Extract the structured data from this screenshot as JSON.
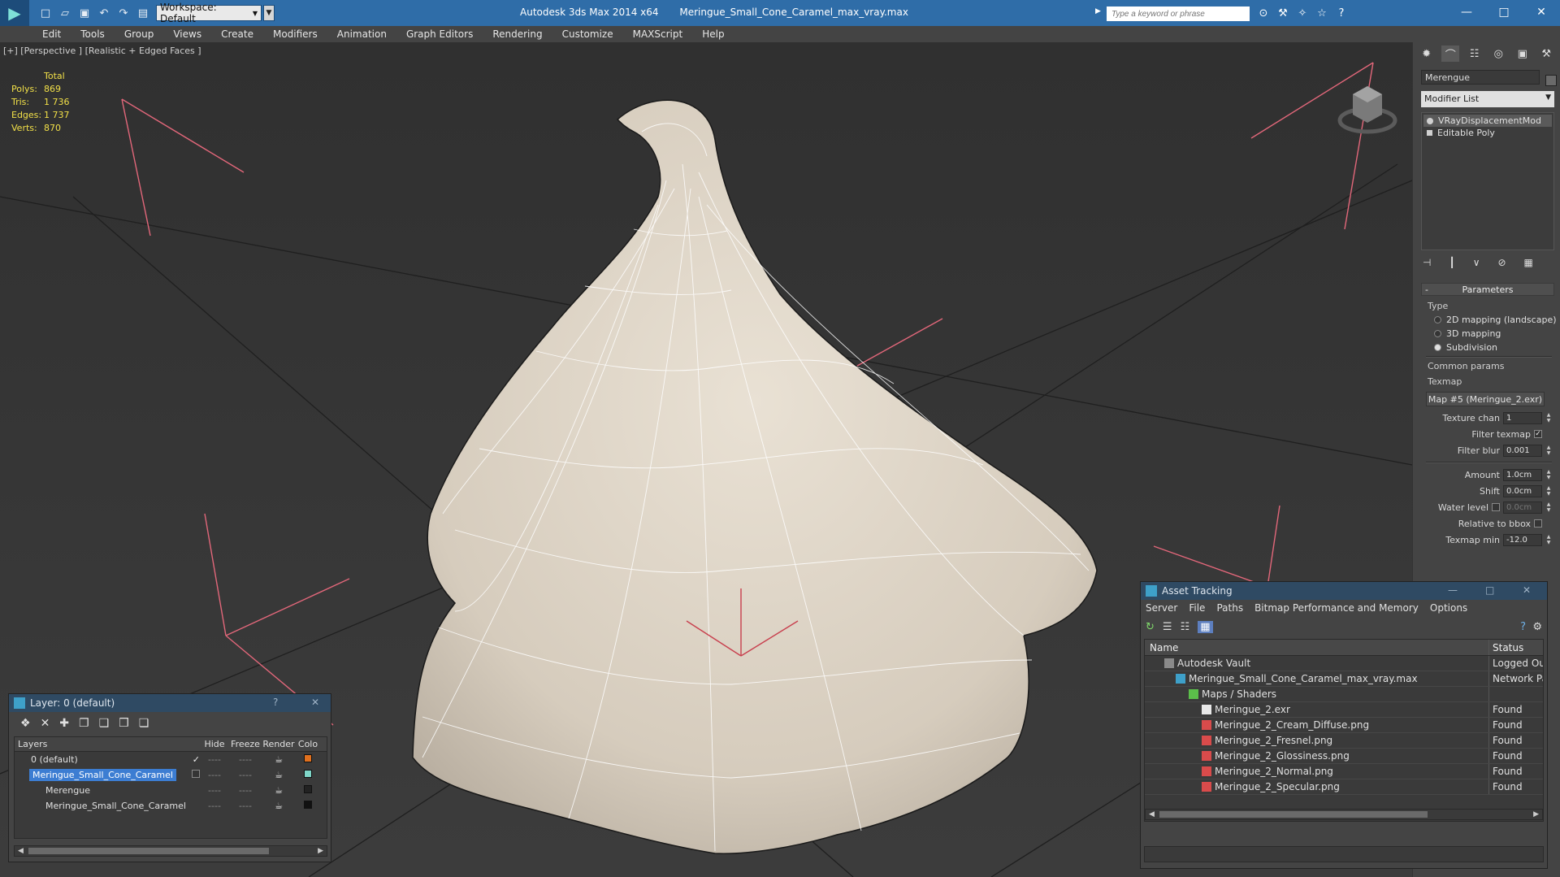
{
  "titlebar": {
    "workspace": "Workspace: Default",
    "app_title": "Autodesk 3ds Max  2014 x64",
    "file_title": "Meringue_Small_Cone_Caramel_max_vray.max",
    "search_placeholder": "Type a keyword or phrase"
  },
  "menu": [
    "Edit",
    "Tools",
    "Group",
    "Views",
    "Create",
    "Modifiers",
    "Animation",
    "Graph Editors",
    "Rendering",
    "Customize",
    "MAXScript",
    "Help"
  ],
  "viewport": {
    "label": "[+] [Perspective ] [Realistic + Edged Faces ]",
    "stats": {
      "header": "Total",
      "rows": [
        {
          "k": "Polys:",
          "v": "869"
        },
        {
          "k": "Tris:",
          "v": "1 736"
        },
        {
          "k": "Edges:",
          "v": "1 737"
        },
        {
          "k": "Verts:",
          "v": "870"
        }
      ]
    },
    "colors": {
      "grid": "#1e1e1e",
      "mesh": "#d9cfc0",
      "wire": "#ffffff",
      "bbox": "#e06a7a"
    }
  },
  "command_panel": {
    "object_name": "Merengue",
    "modifier_list": "Modifier List",
    "stack": [
      "VRayDisplacementMod",
      "Editable Poly"
    ],
    "rollout": "Parameters",
    "type_label": "Type",
    "type_options": [
      "2D mapping (landscape)",
      "3D mapping",
      "Subdivision"
    ],
    "selected_type": "Subdivision",
    "common_label": "Common params",
    "texmap_label": "Texmap",
    "texmap_value": "Map #5 (Meringue_2.exr)",
    "texture_chan_label": "Texture chan",
    "texture_chan": "1",
    "filter_texmap_label": "Filter texmap",
    "filter_blur_label": "Filter blur",
    "filter_blur": "0.001",
    "amount_label": "Amount",
    "amount": "1.0cm",
    "shift_label": "Shift",
    "shift": "0.0cm",
    "water_label": "Water level",
    "water": "0.0cm",
    "relative_label": "Relative to bbox",
    "texmap_min_label": "Texmap min",
    "texmap_min": "-12.0"
  },
  "layer_window": {
    "title": "Layer: 0 (default)",
    "help": "?",
    "columns": [
      "Layers",
      "Hide",
      "Freeze",
      "Render",
      "Colo"
    ],
    "rows": [
      {
        "name": "0 (default)",
        "color": "#e0701e"
      },
      {
        "name": "Meringue_Small_Cone_Caramel",
        "color": "#7fd6c8"
      },
      {
        "name": "Merengue",
        "color": "#222222"
      },
      {
        "name": "Meringue_Small_Cone_Caramel",
        "color": "#111111"
      }
    ]
  },
  "asset_window": {
    "title": "Asset Tracking",
    "menu": [
      "Server",
      "File",
      "Paths",
      "Bitmap Performance and Memory",
      "Options"
    ],
    "columns": [
      "Name",
      "Status"
    ],
    "rows": [
      {
        "name": "Autodesk Vault",
        "status": "Logged Out",
        "indent": 1
      },
      {
        "name": "Meringue_Small_Cone_Caramel_max_vray.max",
        "status": "Network Pat",
        "indent": 2
      },
      {
        "name": "Maps / Shaders",
        "status": "",
        "indent": 3
      },
      {
        "name": "Meringue_2.exr",
        "status": "Found",
        "indent": 4
      },
      {
        "name": "Meringue_2_Cream_Diffuse.png",
        "status": "Found",
        "indent": 4
      },
      {
        "name": "Meringue_2_Fresnel.png",
        "status": "Found",
        "indent": 4
      },
      {
        "name": "Meringue_2_Glossiness.png",
        "status": "Found",
        "indent": 4
      },
      {
        "name": "Meringue_2_Normal.png",
        "status": "Found",
        "indent": 4
      },
      {
        "name": "Meringue_2_Specular.png",
        "status": "Found",
        "indent": 4
      }
    ]
  }
}
